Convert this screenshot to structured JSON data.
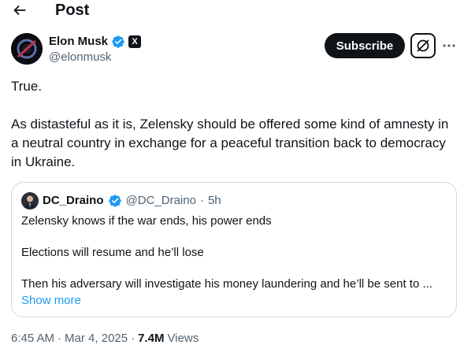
{
  "header": {
    "title": "Post",
    "back_icon": "arrow-left-icon"
  },
  "author": {
    "name": "Elon Musk",
    "handle": "@elonmusk",
    "verified_color": "#1d9bf0",
    "affiliate_badge": "X"
  },
  "actions": {
    "subscribe_label": "Subscribe",
    "grok_icon": "grok-icon",
    "more_icon": "more-icon"
  },
  "post": {
    "paragraphs": [
      "True.",
      "As distasteful as it is, Zelensky should be offered some kind of amnesty in a neutral country in exchange for a peaceful transition back to democracy in Ukraine."
    ]
  },
  "quote": {
    "name": "DC_Draino",
    "handle": "@DC_Draino",
    "separator": "·",
    "time": "5h",
    "lines": [
      "Zelensky knows if the war ends, his power ends",
      "Elections will resume and he’ll lose",
      "Then his adversary will investigate his money laundering and he’ll be sent to ..."
    ],
    "show_more": "Show more"
  },
  "meta": {
    "time": "6:45 AM",
    "separator": "·",
    "date": "Mar 4, 2025",
    "separator2": "·",
    "views_count": "7.4M",
    "views_label": "Views"
  },
  "colors": {
    "text": "#0f1419",
    "secondary": "#536471",
    "link": "#1d9bf0",
    "border": "#cfd9de"
  }
}
